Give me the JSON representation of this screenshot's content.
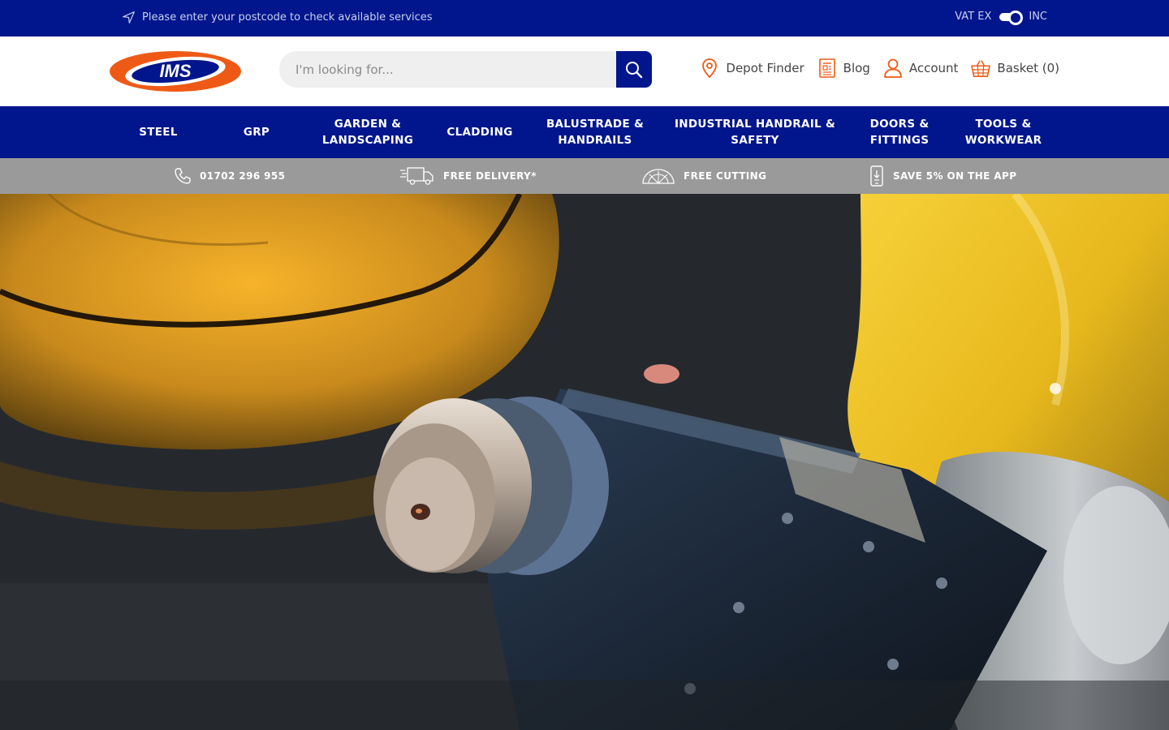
{
  "topbar": {
    "postcode_text": "Please enter your postcode to check available services",
    "vat_ex": "VAT EX",
    "vat_inc": "INC"
  },
  "header": {
    "logo_text": "IMS",
    "search_placeholder": "I'm looking for...",
    "links": {
      "depot": "Depot Finder",
      "blog": "Blog",
      "account": "Account",
      "basket": "Basket (0)"
    }
  },
  "nav": {
    "items": [
      {
        "label": "STEEL"
      },
      {
        "label": "GRP"
      },
      {
        "label": "GARDEN &\nLANDSCAPING"
      },
      {
        "label": "CLADDING"
      },
      {
        "label": "BALUSTRADE &\nHANDRAILS"
      },
      {
        "label": "INDUSTRIAL HANDRAIL &\nSAFETY"
      },
      {
        "label": "DOORS &\nFITTINGS"
      },
      {
        "label": "TOOLS &\nWORKWEAR"
      }
    ]
  },
  "usp": {
    "phone": "01702 296 955",
    "delivery": "FREE DELIVERY*",
    "cutting": "FREE CUTTING",
    "app": "SAVE 5% ON THE APP"
  },
  "colors": {
    "brand_blue": "#01168c",
    "brand_orange": "#ee5a16",
    "usp_grey": "#9a9a9a"
  },
  "icons": [
    "location-arrow-icon",
    "map-pin-icon",
    "blog-icon",
    "user-icon",
    "basket-icon",
    "search-icon",
    "phone-icon",
    "truck-icon",
    "protractor-icon",
    "mobile-app-icon"
  ]
}
